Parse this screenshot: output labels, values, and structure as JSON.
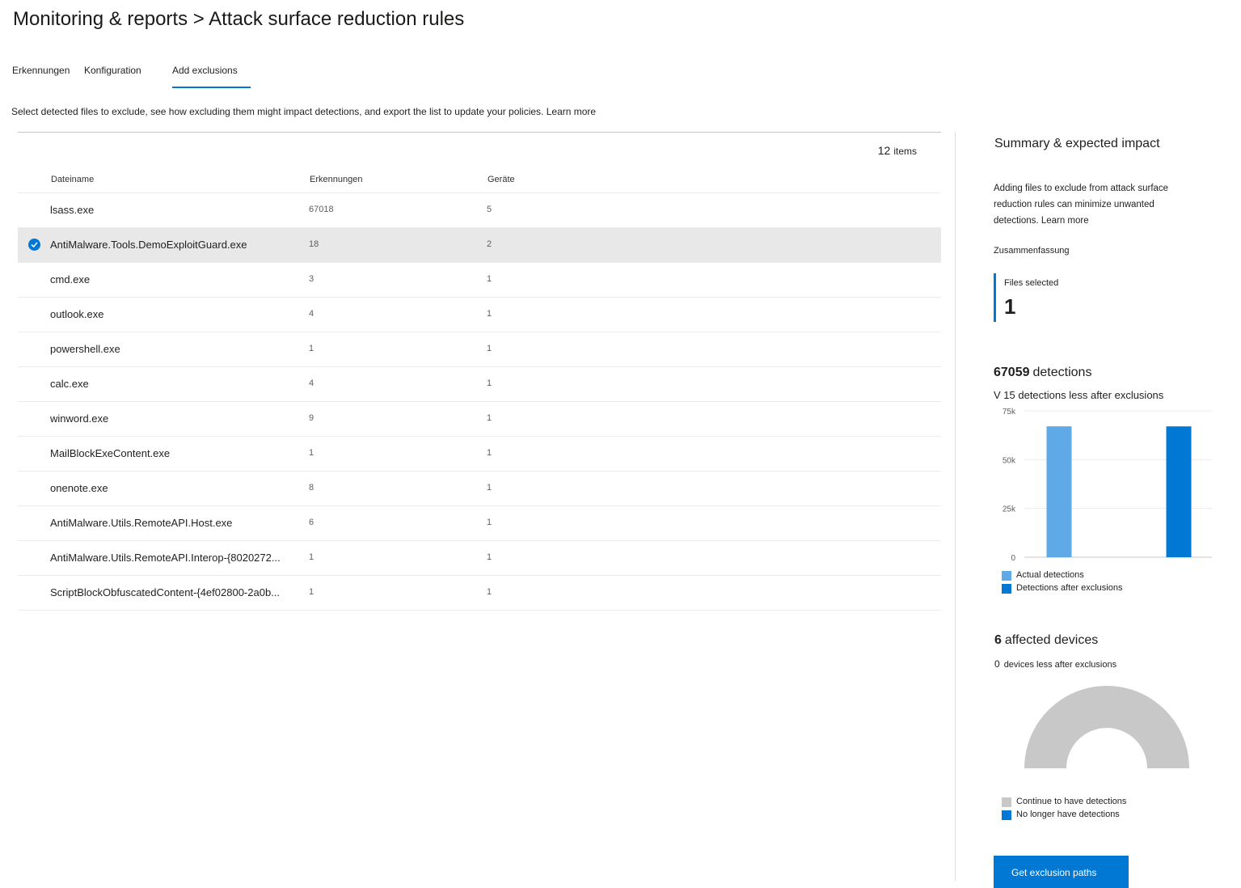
{
  "breadcrumb": "Monitoring & reports > Attack surface reduction rules",
  "tabs": [
    {
      "label": "Erkennungen"
    },
    {
      "label": "Konfiguration"
    },
    {
      "label": "Add exclusions",
      "active": true
    }
  ],
  "description": {
    "text": "Select detected files to exclude, see how excluding them might impact detections, and export the list to update your policies.",
    "link": "Learn more"
  },
  "table": {
    "count": "12",
    "count_label": "items",
    "columns": [
      "Dateiname",
      "Erkennungen",
      "Geräte"
    ],
    "rows": [
      {
        "name": "lsass.exe",
        "detections": "67018",
        "devices": "5",
        "selected": false
      },
      {
        "name": "AntiMalware.Tools.DemoExploitGuard.exe",
        "detections": "18",
        "devices": "2",
        "selected": true
      },
      {
        "name": "cmd.exe",
        "detections": "3",
        "devices": "1",
        "selected": false
      },
      {
        "name": "outlook.exe",
        "detections": "4",
        "devices": "1",
        "selected": false
      },
      {
        "name": "powershell.exe",
        "detections": "1",
        "devices": "1",
        "selected": false
      },
      {
        "name": "calc.exe",
        "detections": "4",
        "devices": "1",
        "selected": false
      },
      {
        "name": "winword.exe",
        "detections": "9",
        "devices": "1",
        "selected": false
      },
      {
        "name": "MailBlockExeContent.exe",
        "detections": "1",
        "devices": "1",
        "selected": false
      },
      {
        "name": "onenote.exe",
        "detections": "8",
        "devices": "1",
        "selected": false
      },
      {
        "name": "AntiMalware.Utils.RemoteAPI.Host.exe",
        "detections": "6",
        "devices": "1",
        "selected": false
      },
      {
        "name": "AntiMalware.Utils.RemoteAPI.Interop-{8020272...",
        "detections": "1",
        "devices": "1",
        "selected": false
      },
      {
        "name": "ScriptBlockObfuscatedContent-{4ef02800-2a0b...",
        "detections": "1",
        "devices": "1",
        "selected": false
      }
    ]
  },
  "summary": {
    "title": "Summary & expected impact",
    "description": "Adding files to exclude from attack surface reduction rules can minimize unwanted detections. Learn more",
    "subtitle": "Zusammenfassung",
    "files_selected_label": "Files selected",
    "files_selected_value": "1",
    "detections_total": "67059",
    "detections_label": "detections",
    "detections_less": "V 15 detections less after exclusions",
    "devices_total": "6",
    "devices_label": "affected devices",
    "devices_less_value": "0",
    "devices_less_label": "devices less after exclusions",
    "button_label": "Get exclusion paths"
  },
  "colors": {
    "accent": "#0078d4",
    "actual": "#5ea9e6",
    "after": "#0078d4",
    "continue": "#c8c8c8"
  },
  "chart_data": [
    {
      "type": "bar",
      "categories": [
        "Actual detections",
        "Detections after exclusions"
      ],
      "series": [
        {
          "name": "Actual detections",
          "values": [
            67059
          ]
        },
        {
          "name": "Detections after exclusions",
          "values": [
            67044
          ]
        }
      ],
      "values": [
        67059,
        67044
      ],
      "ylim": [
        0,
        75000
      ],
      "yticks": [
        "0",
        "25k",
        "50k",
        "75k"
      ],
      "ytick_values": [
        0,
        25000,
        50000,
        75000
      ],
      "grid": true,
      "legend": "bottom-left"
    },
    {
      "type": "pie",
      "style": "half-donut",
      "categories": [
        "Continue to have detections",
        "No longer have detections"
      ],
      "values": [
        6,
        0
      ],
      "legend": "bottom-left"
    }
  ]
}
